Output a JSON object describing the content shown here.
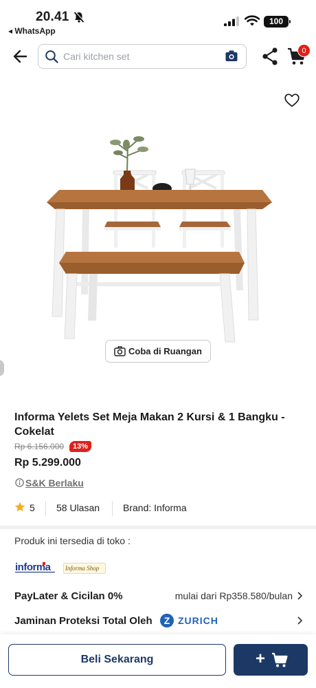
{
  "status_bar": {
    "time": "20.41",
    "back_app": "◂ WhatsApp",
    "battery": "100"
  },
  "header": {
    "search_placeholder": "Cari kitchen set",
    "cart_count": "0"
  },
  "product": {
    "try_in_room": "Coba di Ruangan",
    "title": "Informa Yelets Set Meja Makan 2 Kursi & 1 Bangku - Cokelat",
    "old_price": "Rp 6.156.000",
    "discount": "13%",
    "price": "Rp 5.299.000",
    "terms": "S&K Berlaku",
    "rating": "5",
    "reviews": "58 Ulasan",
    "brand": "Brand: Informa"
  },
  "availability": {
    "label": "Produk ini tersedia di toko :",
    "stores": [
      "informa",
      "Informa Shop"
    ]
  },
  "paylater": {
    "label": "PayLater & Cicilan 0%",
    "value": "mulai dari Rp358.580/bulan"
  },
  "protection": {
    "label": "Jaminan Proteksi Total Oleh",
    "partner": "ZURICH"
  },
  "bottom_bar": {
    "buy_label": "Beli Sekarang"
  },
  "colors": {
    "brand_navy": "#1c3966",
    "discount_red": "#e0201b",
    "zurich_blue": "#1f62b8"
  }
}
